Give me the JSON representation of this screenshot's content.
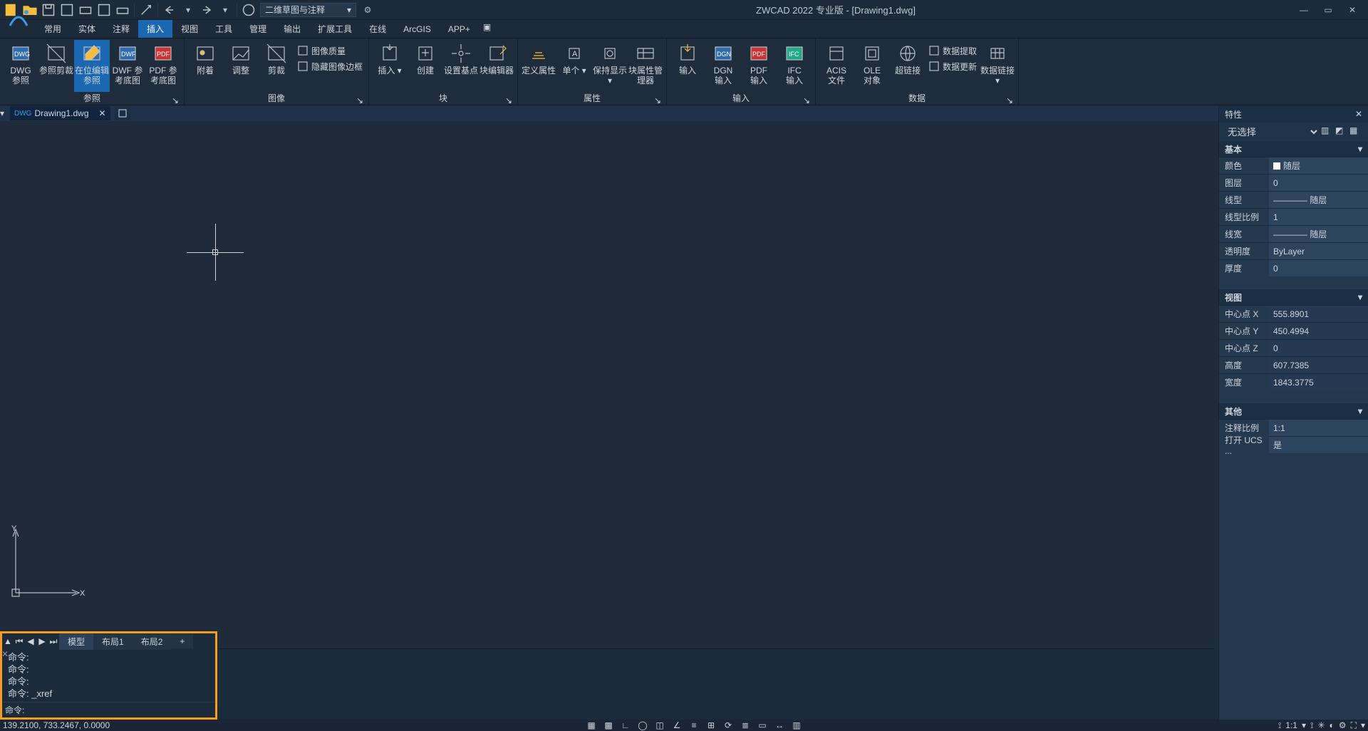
{
  "workspace_name": "二维草图与注释",
  "title": "ZWCAD 2022 专业版 - [Drawing1.dwg]",
  "menu": [
    "常用",
    "实体",
    "注释",
    "插入",
    "视图",
    "工具",
    "管理",
    "输出",
    "扩展工具",
    "在线",
    "ArcGIS",
    "APP+"
  ],
  "menu_active": 3,
  "ribbon": {
    "panels": [
      {
        "label": "参照",
        "launcher": true,
        "big": [
          {
            "name": "dwg-ref",
            "txt": "DWG\n参照"
          },
          {
            "name": "ref-clip",
            "txt": "参照剪裁"
          },
          {
            "name": "edit-ref-inplace",
            "txt": "在位编辑参照",
            "active": true
          },
          {
            "name": "dwf-underlay",
            "txt": "DWF 参\n考底图"
          },
          {
            "name": "pdf-underlay",
            "txt": "PDF 参\n考底图"
          }
        ]
      },
      {
        "label": "图像",
        "launcher": true,
        "big": [
          {
            "name": "attach",
            "txt": "附着"
          },
          {
            "name": "adjust",
            "txt": "调整"
          },
          {
            "name": "clip",
            "txt": "剪裁"
          }
        ],
        "small": [
          {
            "name": "image-quality",
            "txt": "图像质量"
          },
          {
            "name": "hide-image-border",
            "txt": "隐藏图像边框"
          }
        ]
      },
      {
        "label": "块",
        "launcher": true,
        "big": [
          {
            "name": "insert",
            "txt": "插入",
            "dd": true
          },
          {
            "name": "create",
            "txt": "创建"
          },
          {
            "name": "set-base",
            "txt": "设置基点"
          },
          {
            "name": "block-editor",
            "txt": "块编辑器"
          }
        ]
      },
      {
        "label": "属性",
        "launcher": true,
        "big": [
          {
            "name": "def-attr",
            "txt": "定义属性"
          },
          {
            "name": "single",
            "txt": "单个",
            "dd": true
          },
          {
            "name": "keep-display",
            "txt": "保持显示",
            "dd": true
          },
          {
            "name": "block-attr-mgr",
            "txt": "块属性管理器"
          }
        ]
      },
      {
        "label": "输入",
        "launcher": true,
        "big": [
          {
            "name": "import",
            "txt": "输入"
          },
          {
            "name": "dgn-import",
            "txt": "DGN\n输入"
          },
          {
            "name": "pdf-import",
            "txt": "PDF\n输入"
          },
          {
            "name": "ifc-import",
            "txt": "IFC\n输入"
          }
        ]
      },
      {
        "label": "数据",
        "launcher": true,
        "big": [
          {
            "name": "acis-file",
            "txt": "ACIS\n文件"
          },
          {
            "name": "ole-obj",
            "txt": "OLE\n对象"
          },
          {
            "name": "hyperlink",
            "txt": "超链接"
          }
        ],
        "small": [
          {
            "name": "data-extract",
            "txt": "数据提取"
          },
          {
            "name": "data-update",
            "txt": "数据更新"
          }
        ],
        "big_after": [
          {
            "name": "data-link",
            "txt": "数据链接",
            "dd": true
          }
        ]
      }
    ]
  },
  "doc_tab": "Drawing1.dwg",
  "layout_tabs": {
    "active": "模型",
    "others": [
      "布局1",
      "布局2"
    ]
  },
  "command_history": [
    "命令:",
    "命令:",
    "命令:",
    "命令: _xref"
  ],
  "command_prompt": "命令:",
  "coords": "139.2100, 733.2467, 0.0000",
  "anno_scale": "1:1",
  "props": {
    "title": "特性",
    "selection": "无选择",
    "sections": {
      "basic": {
        "title": "基本",
        "rows": [
          {
            "k": "颜色",
            "v": "随层",
            "swatch": true
          },
          {
            "k": "图层",
            "v": "0"
          },
          {
            "k": "线型",
            "v": "———— 随层"
          },
          {
            "k": "线型比例",
            "v": "1"
          },
          {
            "k": "线宽",
            "v": "———— 随层"
          },
          {
            "k": "透明度",
            "v": "ByLayer"
          },
          {
            "k": "厚度",
            "v": "0"
          }
        ]
      },
      "view": {
        "title": "视图",
        "rows": [
          {
            "k": "中心点 X",
            "v": "555.8901",
            "ro": true
          },
          {
            "k": "中心点 Y",
            "v": "450.4994",
            "ro": true
          },
          {
            "k": "中心点 Z",
            "v": "0",
            "ro": true
          },
          {
            "k": "高度",
            "v": "607.7385",
            "ro": true
          },
          {
            "k": "宽度",
            "v": "1843.3775",
            "ro": true
          }
        ]
      },
      "misc": {
        "title": "其他",
        "rows": [
          {
            "k": "注释比例",
            "v": "1:1"
          },
          {
            "k": "打开 UCS ...",
            "v": "是"
          }
        ]
      }
    }
  }
}
